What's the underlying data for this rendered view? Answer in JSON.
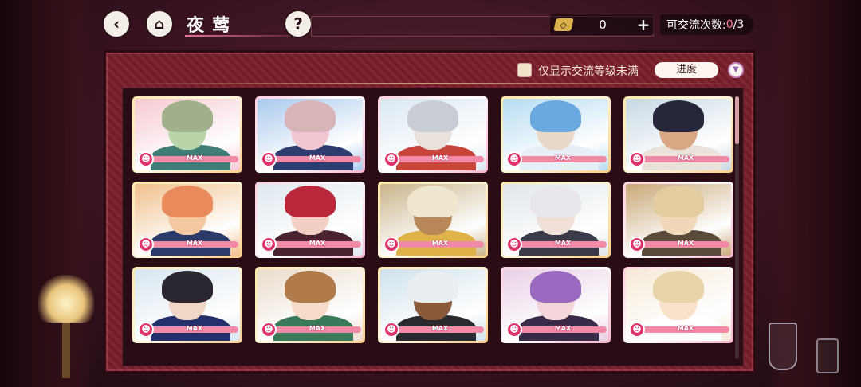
{
  "header": {
    "back_icon": "back-arrow-icon",
    "home_icon": "building-icon",
    "title": "夜莺",
    "help_label": "?",
    "currency": {
      "icon": "ticket-icon",
      "value": "0",
      "plus_label": "+"
    },
    "exchange": {
      "label": "可交流次数: ",
      "current": "0",
      "max": "/3"
    }
  },
  "filter": {
    "checkbox_label": "仅显示交流等级未满",
    "sort_label": "进度",
    "sort_toggle": "▼"
  },
  "cards": [
    {
      "level_label": "MAX",
      "progress": 1.0
    },
    {
      "level_label": "MAX",
      "progress": 1.0
    },
    {
      "level_label": "MAX",
      "progress": 1.0
    },
    {
      "level_label": "MAX",
      "progress": 1.0
    },
    {
      "level_label": "MAX",
      "progress": 1.0
    },
    {
      "level_label": "MAX",
      "progress": 1.0
    },
    {
      "level_label": "MAX",
      "progress": 1.0
    },
    {
      "level_label": "MAX",
      "progress": 1.0
    },
    {
      "level_label": "MAX",
      "progress": 1.0
    },
    {
      "level_label": "MAX",
      "progress": 1.0
    },
    {
      "level_label": "MAX",
      "progress": 1.0
    },
    {
      "level_label": "MAX",
      "progress": 1.0
    },
    {
      "level_label": "MAX",
      "progress": 1.0
    },
    {
      "level_label": "MAX",
      "progress": 1.0
    },
    {
      "level_label": "MAX",
      "progress": 1.0
    }
  ],
  "colors": {
    "accent_pink": "#e0336a",
    "frame_gold": "#ffe9a8",
    "panel_red": "#7a1f2c"
  }
}
